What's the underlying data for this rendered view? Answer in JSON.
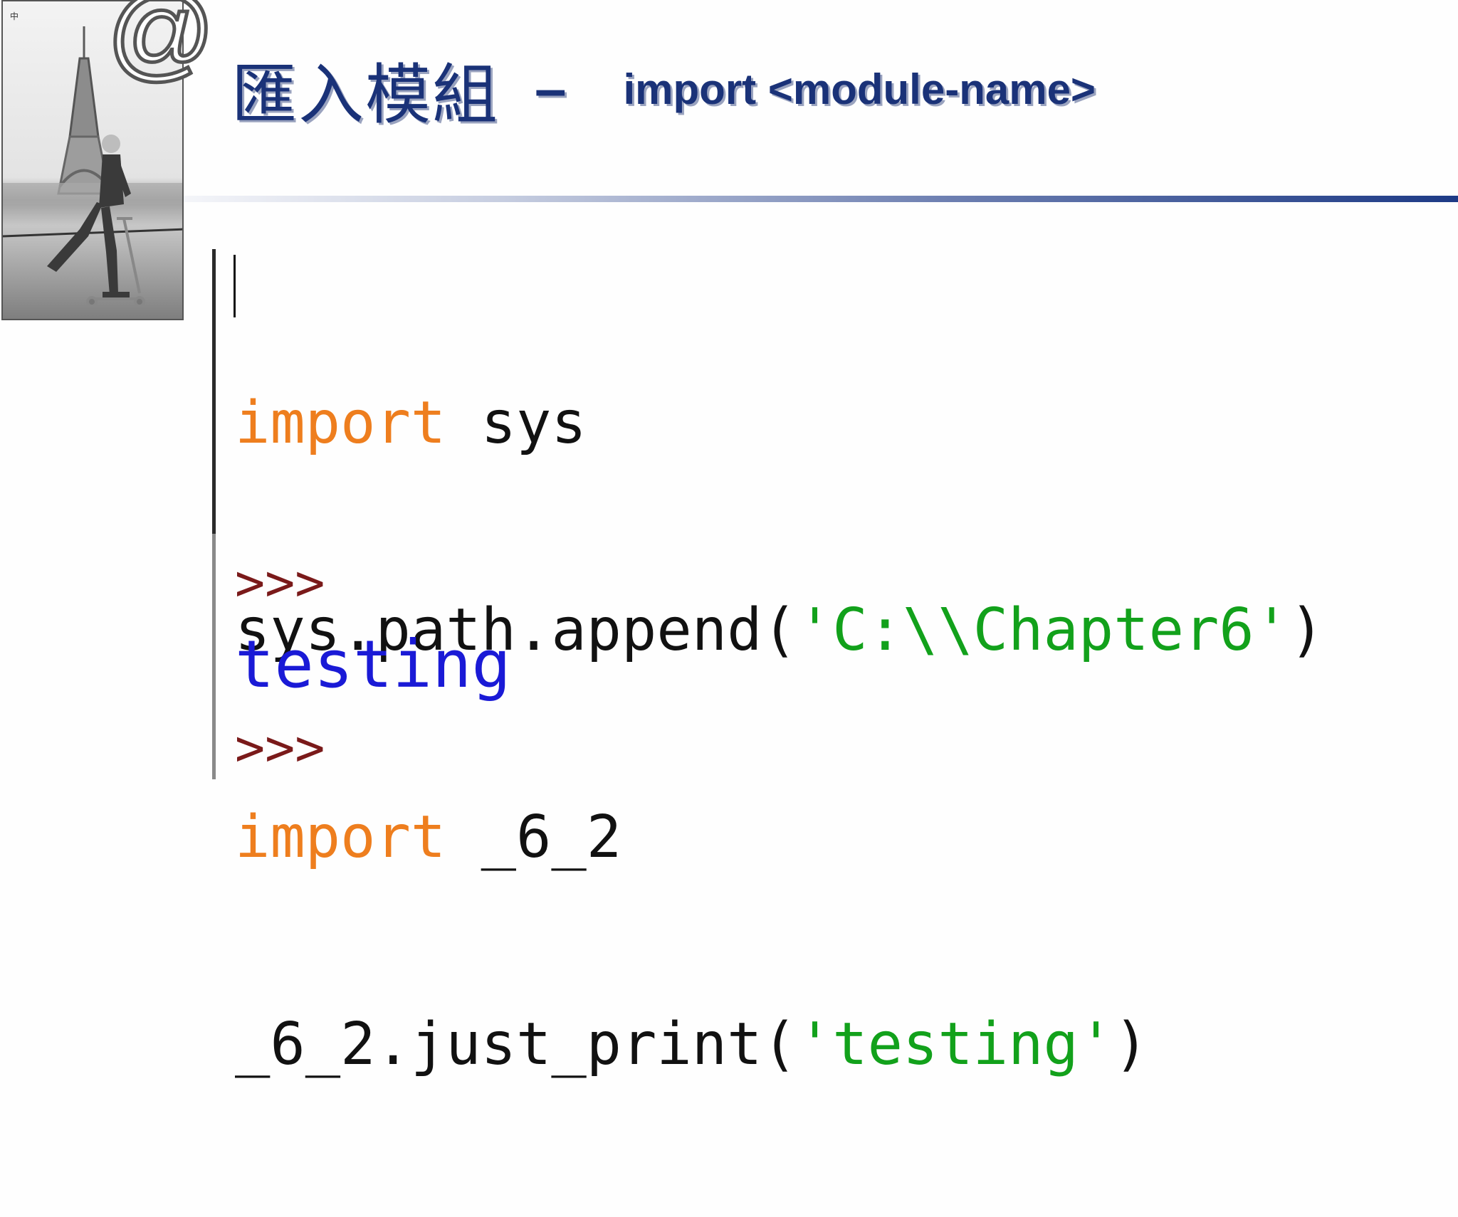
{
  "slide": {
    "title_cn": "匯入模組",
    "title_dash": "–",
    "title_en": "import <module-name>",
    "corner_symbol": "@",
    "corner_mark": "中",
    "photo_icon": "man-on-scooter-eiffel-tower-photo"
  },
  "code": {
    "line1_kw": "import",
    "line1_rest": " sys",
    "line2_pre": "sys.path.append(",
    "line2_str": "'C:\\\\Chapter6'",
    "line2_post": ")",
    "line3_kw": "import",
    "line3_rest": " _6_2",
    "line4_pre": "_6_2.just_print(",
    "line4_str": "'testing'",
    "line4_post": ")"
  },
  "shell": {
    "prompt1": ">>>",
    "output": "testing",
    "prompt2": ">>>"
  },
  "colors": {
    "title": "#1a3278",
    "keyword": "#ee7e1e",
    "string": "#12a11b",
    "prompt": "#7a1a1a",
    "output": "#1a1ad6"
  }
}
